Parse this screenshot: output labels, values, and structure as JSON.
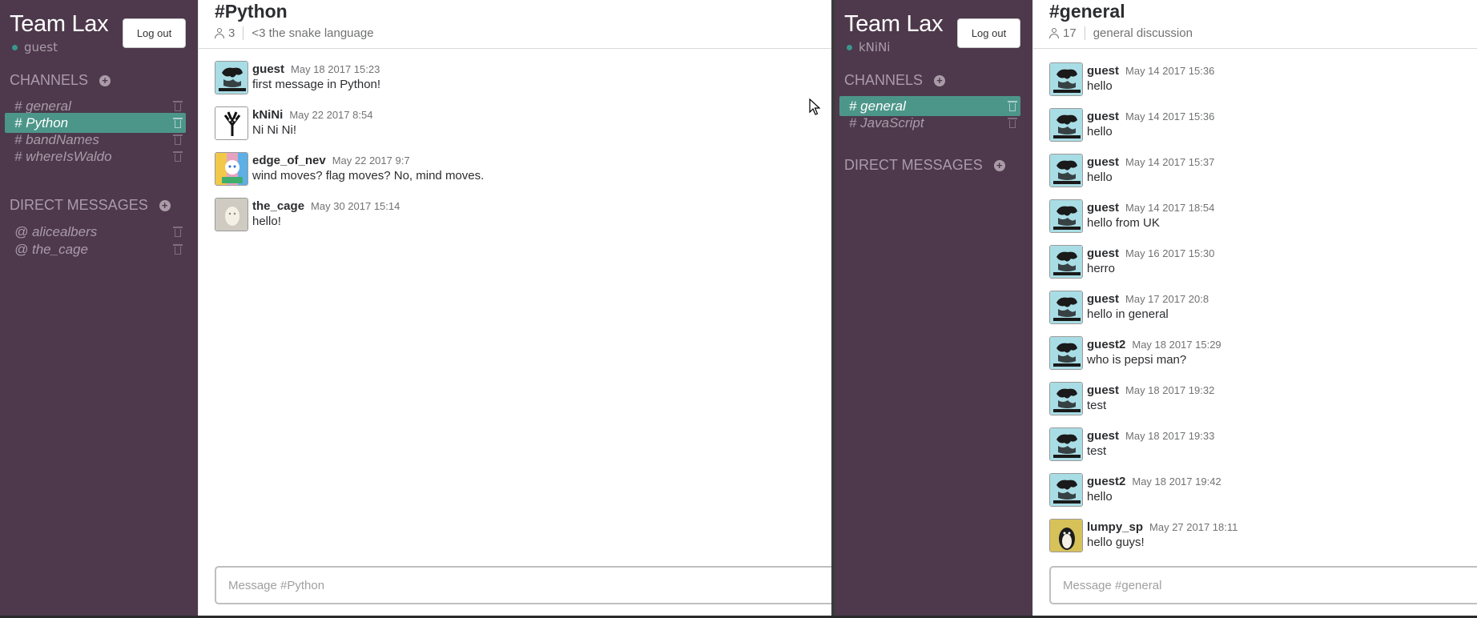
{
  "left": {
    "sidebar": {
      "team_name": "Team Lax",
      "username": "guest",
      "logout_label": "Log out",
      "channels_heading": "CHANNELS",
      "channels": [
        {
          "label": "# general"
        },
        {
          "label": "# Python",
          "active": true
        },
        {
          "label": "# bandNames"
        },
        {
          "label": "# whereIsWaldo"
        }
      ],
      "dm_heading": "DIRECT MESSAGES",
      "dms": [
        {
          "label": "@ alicealbers"
        },
        {
          "label": "@ the_cage"
        }
      ]
    },
    "header": {
      "title": "#Python",
      "member_count": "3",
      "description": "<3 the snake language"
    },
    "messages": [
      {
        "user": "guest",
        "time": "May 18 2017 15:23",
        "text": "first message in Python!",
        "avatar": "philosoraptor"
      },
      {
        "user": "kNiNi",
        "time": "May 22 2017 8:54",
        "text": "Ni Ni Ni!",
        "avatar": "tree"
      },
      {
        "user": "edge_of_nev",
        "time": "May 22 2017 9:7",
        "text": "wind moves? flag moves? No, mind moves.",
        "avatar": "colorful"
      },
      {
        "user": "the_cage",
        "time": "May 30 2017 15:14",
        "text": "hello!",
        "avatar": "egg"
      }
    ],
    "composer_placeholder": "Message #Python"
  },
  "right": {
    "sidebar": {
      "team_name": "Team Lax",
      "username": "kNiNi",
      "logout_label": "Log out",
      "channels_heading": "CHANNELS",
      "channels": [
        {
          "label": "# general",
          "active": true
        },
        {
          "label": "# JavaScript"
        }
      ],
      "dm_heading": "DIRECT MESSAGES",
      "dms": []
    },
    "header": {
      "title": "#general",
      "member_count": "17",
      "description": "general discussion"
    },
    "messages": [
      {
        "user": "guest",
        "time": "May 14 2017 15:36",
        "text": "hello",
        "avatar": "philosoraptor"
      },
      {
        "user": "guest",
        "time": "May 14 2017 15:36",
        "text": "hello",
        "avatar": "philosoraptor"
      },
      {
        "user": "guest",
        "time": "May 14 2017 15:37",
        "text": "hello",
        "avatar": "philosoraptor"
      },
      {
        "user": "guest",
        "time": "May 14 2017 18:54",
        "text": "hello from UK",
        "avatar": "philosoraptor"
      },
      {
        "user": "guest",
        "time": "May 16 2017 15:30",
        "text": "herro",
        "avatar": "philosoraptor"
      },
      {
        "user": "guest",
        "time": "May 17 2017 20:8",
        "text": "hello in general",
        "avatar": "philosoraptor"
      },
      {
        "user": "guest2",
        "time": "May 18 2017 15:29",
        "text": "who is pepsi man?",
        "avatar": "philosoraptor"
      },
      {
        "user": "guest",
        "time": "May 18 2017 19:32",
        "text": "test",
        "avatar": "philosoraptor"
      },
      {
        "user": "guest",
        "time": "May 18 2017 19:33",
        "text": "test",
        "avatar": "philosoraptor"
      },
      {
        "user": "guest2",
        "time": "May 18 2017 19:42",
        "text": "hello",
        "avatar": "philosoraptor"
      },
      {
        "user": "lumpy_sp",
        "time": "May 27 2017 18:11",
        "text": "hello guys!",
        "avatar": "lumpy"
      }
    ],
    "composer_placeholder": "Message #general"
  },
  "colors": {
    "sidebar_bg": "#4d394b",
    "active_item": "#4c9689",
    "status_online": "#38978d"
  },
  "avatar_styles": {
    "philosoraptor": {
      "bg": "#a9dde5",
      "fg": "#1a1a1a"
    },
    "tree": {
      "bg": "#ffffff",
      "fg": "#111111"
    },
    "colorful": {
      "bg": "#e6a3c0",
      "fg": "#2a6fd1"
    },
    "egg": {
      "bg": "#cfcbc2",
      "fg": "#8a8174"
    },
    "lumpy": {
      "bg": "#d7c25a",
      "fg": "#6a5a2a"
    }
  }
}
